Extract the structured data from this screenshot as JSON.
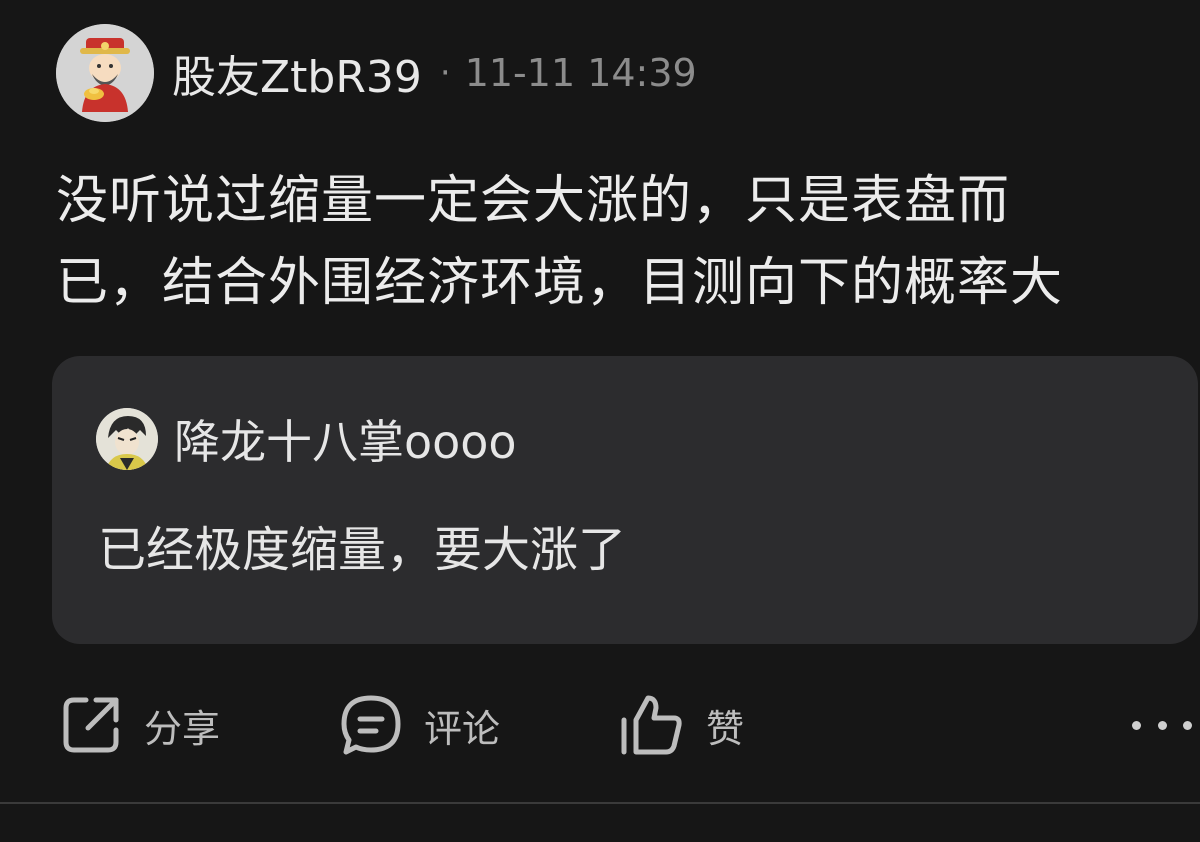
{
  "post": {
    "author": "股友ZtbR39",
    "separator": "·",
    "timestamp": "11-11 14:39",
    "avatar_icon": "caishen-avatar-icon",
    "content_line1": "没听说过缩量一定会大涨的，只是表盘而",
    "content_line2": "已，结合外围经济环境，目测向下的概率大"
  },
  "quote": {
    "author": "降龙十八掌oooo",
    "avatar_icon": "user-avatar-icon",
    "text": "已经极度缩量，要大涨了"
  },
  "actions": {
    "share_label": "分享",
    "share_icon": "share-icon",
    "comment_label": "评论",
    "comment_icon": "comment-icon",
    "like_label": "赞",
    "like_icon": "thumbs-up-icon",
    "more_icon": "more-icon"
  },
  "colors": {
    "background": "#161616",
    "quote_background": "#2c2c2e",
    "muted_text": "#8c8c8c"
  }
}
